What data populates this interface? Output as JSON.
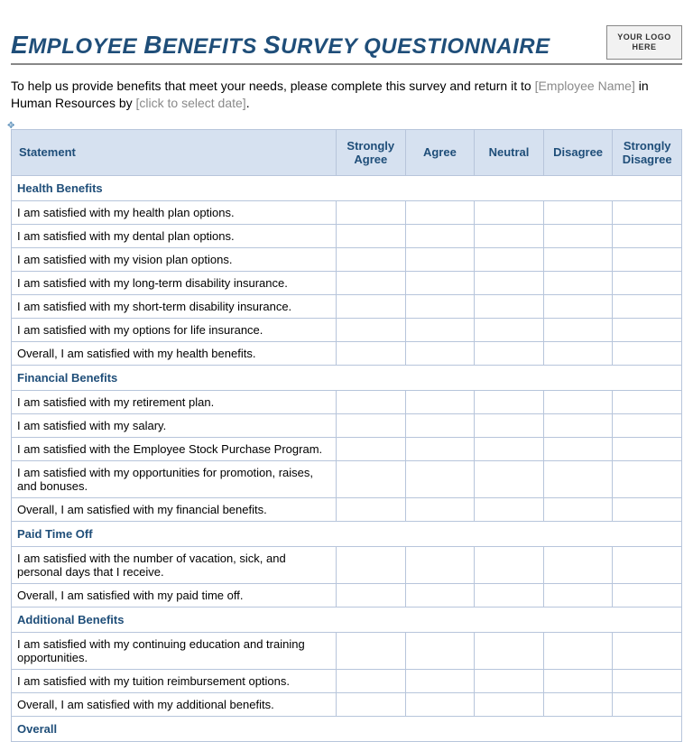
{
  "title": "Employee Benefits Survey questionnaire",
  "logo_text": "YOUR LOGO HERE",
  "intro_pre": "To help us provide benefits that meet your needs, please complete this survey and return it to ",
  "intro_name_placeholder": "[Employee Name]",
  "intro_mid": " in Human Resources by ",
  "intro_date_placeholder": "[click to select date]",
  "intro_post": ".",
  "columns": {
    "statement": "Statement",
    "opts": [
      "Strongly Agree",
      "Agree",
      "Neutral",
      "Disagree",
      "Strongly Disagree"
    ]
  },
  "sections": [
    {
      "heading": "Health Benefits",
      "rows": [
        "I am satisfied with my health plan options.",
        "I am satisfied with my dental plan options.",
        "I am satisfied with my vision plan options.",
        "I am satisfied with my long-term disability insurance.",
        "I am satisfied with my short-term disability insurance.",
        "I am satisfied with my options  for life insurance.",
        "Overall, I am satisfied with my health benefits."
      ]
    },
    {
      "heading": "Financial Benefits",
      "rows": [
        "I am satisfied with my retirement plan.",
        "I am satisfied with my salary.",
        "I am satisfied with the Employee Stock Purchase Program.",
        "I am satisfied with my opportunities  for promotion, raises, and bonuses.",
        "Overall, I am satisfied with my financial benefits."
      ]
    },
    {
      "heading": "Paid Time Off",
      "rows": [
        "I am satisfied with the number of vacation, sick, and personal days that I receive.",
        "Overall, I am satisfied with my paid time off."
      ]
    },
    {
      "heading": "Additional Benefits",
      "rows": [
        "I am satisfied with my continuing education and training opportunities.",
        "I am satisfied with my tuition reimbursement options.",
        "Overall, I am satisfied with my additional benefits."
      ]
    },
    {
      "heading": "Overall",
      "rows": []
    }
  ]
}
